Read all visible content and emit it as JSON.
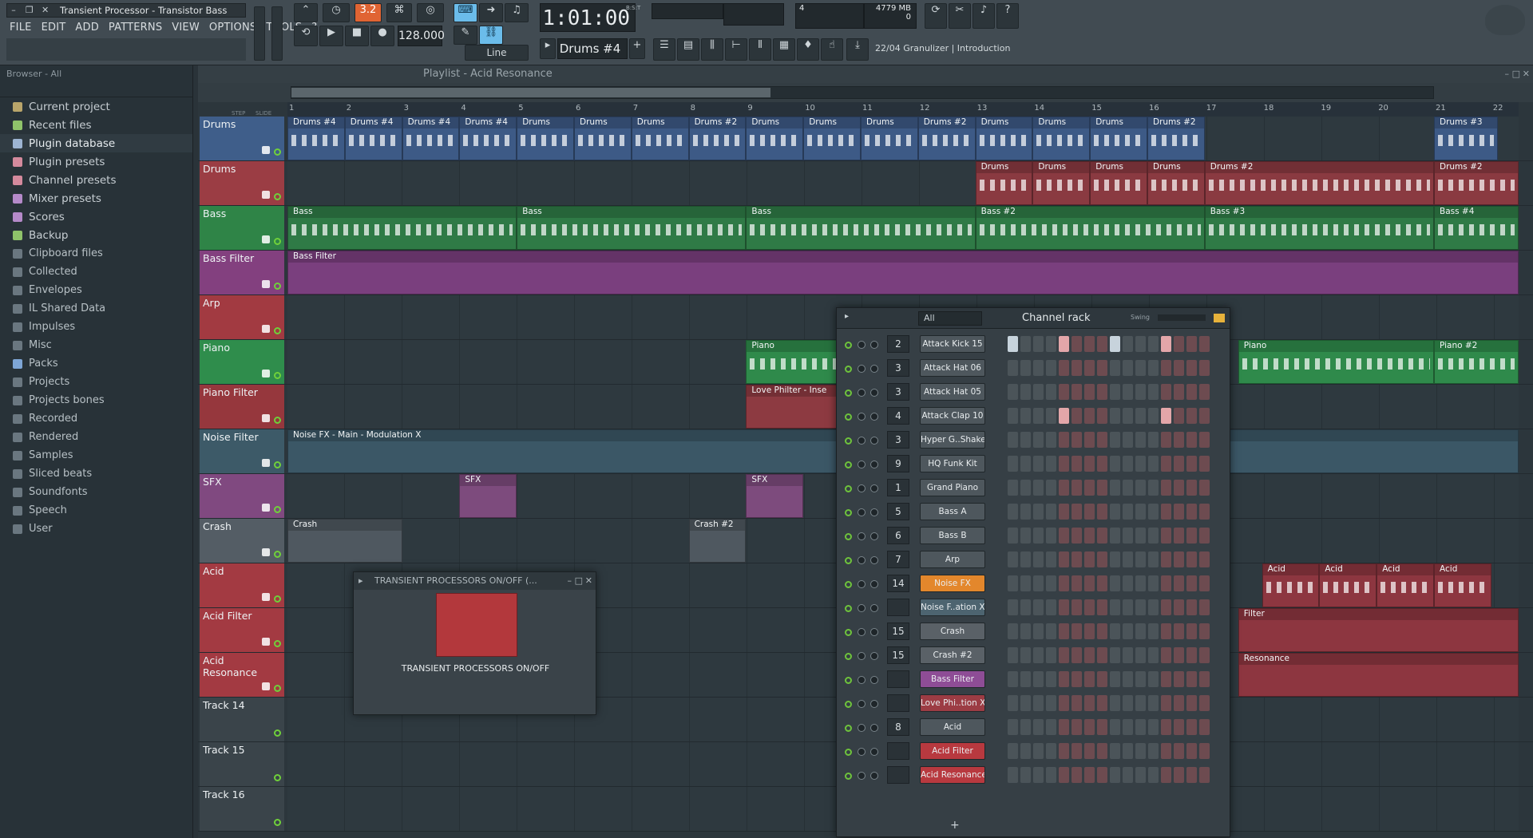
{
  "window": {
    "title": "Transient Processor - Transistor Bass",
    "controls": [
      "–",
      "□",
      "×"
    ]
  },
  "menu": [
    "FILE",
    "EDIT",
    "ADD",
    "PATTERNS",
    "VIEW",
    "OPTIONS",
    "TOOLS",
    "?"
  ],
  "transport": {
    "pattern_mode": "3.2",
    "tempo": "128.000",
    "snap": "Line",
    "time": "1:01:00",
    "time_label": "B:S:T",
    "pattern": "Drums #4",
    "cpu": "4",
    "ram": "4779 MB",
    "polyphony": "0"
  },
  "news": "22/04  Granulizer | Introduction",
  "browser": {
    "header": "Browser - All",
    "items": [
      {
        "label": "Current project",
        "color": "#b9a56a"
      },
      {
        "label": "Recent files",
        "color": "#8fc36a"
      },
      {
        "label": "Plugin database",
        "color": "#9db4d2"
      },
      {
        "label": "Plugin presets",
        "color": "#d48a9d"
      },
      {
        "label": "Channel presets",
        "color": "#d48a9d"
      },
      {
        "label": "Mixer presets",
        "color": "#b58ac9"
      },
      {
        "label": "Scores",
        "color": "#b58ac9"
      },
      {
        "label": "Backup",
        "color": "#8fc36a"
      },
      {
        "label": "Clipboard files",
        "color": "#6a7780"
      },
      {
        "label": "Collected",
        "color": "#6a7780"
      },
      {
        "label": "Envelopes",
        "color": "#6a7780"
      },
      {
        "label": "IL Shared Data",
        "color": "#6a7780"
      },
      {
        "label": "Impulses",
        "color": "#6a7780"
      },
      {
        "label": "Misc",
        "color": "#6a7780"
      },
      {
        "label": "Packs",
        "color": "#7ea6d6"
      },
      {
        "label": "Projects",
        "color": "#6a7780"
      },
      {
        "label": "Projects bones",
        "color": "#6a7780"
      },
      {
        "label": "Recorded",
        "color": "#6a7780"
      },
      {
        "label": "Rendered",
        "color": "#6a7780"
      },
      {
        "label": "Samples",
        "color": "#6a7780"
      },
      {
        "label": "Sliced beats",
        "color": "#6a7780"
      },
      {
        "label": "Soundfonts",
        "color": "#6a7780"
      },
      {
        "label": "Speech",
        "color": "#6a7780"
      },
      {
        "label": "User",
        "color": "#6a7780"
      }
    ]
  },
  "playlist": {
    "title": "Playlist - Acid Resonance",
    "step_label": "STEP",
    "slide_label": "SLIDE",
    "bars": [
      "1",
      "2",
      "3",
      "4",
      "5",
      "6",
      "7",
      "8",
      "9",
      "10",
      "11",
      "12",
      "13",
      "14",
      "15",
      "16",
      "17",
      "18",
      "19",
      "20",
      "21",
      "22"
    ],
    "tracks": [
      {
        "name": "Drums",
        "color": "#3f5e8a"
      },
      {
        "name": "Drums",
        "color": "#9b3d44"
      },
      {
        "name": "Bass",
        "color": "#2f8447"
      },
      {
        "name": "Bass Filter",
        "color": "#83407f"
      },
      {
        "name": "Arp",
        "color": "#a23a41"
      },
      {
        "name": "Piano",
        "color": "#2f8d4c"
      },
      {
        "name": "Piano Filter",
        "color": "#96373d"
      },
      {
        "name": "Noise Filter",
        "color": "#3d5a68"
      },
      {
        "name": "SFX",
        "color": "#804980"
      },
      {
        "name": "Crash",
        "color": "#545d65"
      },
      {
        "name": "Acid",
        "color": "#a33a42"
      },
      {
        "name": "Acid Filter",
        "color": "#a33a42"
      },
      {
        "name": "Acid Resonance",
        "color": "#a33a42"
      },
      {
        "name": "Track 14",
        "color": "#3a444a"
      },
      {
        "name": "Track 15",
        "color": "#3a444a"
      },
      {
        "name": "Track 16",
        "color": "#3a444a"
      }
    ],
    "clips": {
      "drums_row": [
        "Drums #4",
        "Drums #4",
        "Drums #4",
        "Drums #4",
        "Drums",
        "Drums",
        "Drums",
        "Drums #2",
        "Drums",
        "Drums",
        "Drums",
        "Drums #2",
        "Drums",
        "Drums",
        "Drums",
        "Drums #2",
        "Drums #3"
      ],
      "drums2_row": [
        "Drums",
        "Drums",
        "Drums",
        "Drums",
        "Drums #2",
        "Drums #2"
      ],
      "bass_row": [
        "Bass",
        "Bass",
        "Bass",
        "Bass #2",
        "Bass #3",
        "Bass #4"
      ],
      "bass_filter": "Bass Filter",
      "piano_row": [
        "Piano",
        "Piano",
        "Piano #2"
      ],
      "piano_filter": "Love Philter - Inse",
      "noise_filter": "Noise FX - Main - Modulation X",
      "sfx_row": [
        "SFX",
        "SFX"
      ],
      "crash_row": [
        "Crash",
        "Crash #2"
      ],
      "acid_row": [
        "Acid",
        "Acid",
        "Acid",
        "Acid"
      ],
      "acid_filter": "Filter",
      "acid_res": "Resonance"
    }
  },
  "channel_rack": {
    "title": "Channel rack",
    "filter": "All",
    "swing_label": "Swing",
    "add": "+",
    "channels": [
      {
        "num": "2",
        "name": "Attack Kick 15",
        "color": "#4e575d",
        "pattern": [
          1,
          0,
          0,
          0,
          1,
          0,
          0,
          0,
          1,
          0,
          0,
          0,
          1,
          0,
          0,
          0
        ]
      },
      {
        "num": "3",
        "name": "Attack Hat 06",
        "color": "#4e575d",
        "pattern": [
          0,
          0,
          0,
          0,
          0,
          0,
          0,
          0,
          0,
          0,
          0,
          0,
          0,
          0,
          0,
          0
        ]
      },
      {
        "num": "3",
        "name": "Attack Hat 05",
        "color": "#4e575d",
        "pattern": [
          0,
          0,
          0,
          0,
          0,
          0,
          0,
          0,
          0,
          0,
          0,
          0,
          0,
          0,
          0,
          0
        ]
      },
      {
        "num": "4",
        "name": "Attack Clap 10",
        "color": "#4e575d",
        "pattern": [
          0,
          0,
          0,
          0,
          1,
          0,
          0,
          0,
          0,
          0,
          0,
          0,
          1,
          0,
          0,
          0
        ]
      },
      {
        "num": "3",
        "name": "Hyper G..Shaker",
        "color": "#4e575d",
        "pattern": [
          0,
          0,
          0,
          0,
          0,
          0,
          0,
          0,
          0,
          0,
          0,
          0,
          0,
          0,
          0,
          0
        ]
      },
      {
        "num": "9",
        "name": "HQ Funk Kit",
        "color": "#4e575d",
        "pattern": [
          0,
          0,
          0,
          0,
          0,
          0,
          0,
          0,
          0,
          0,
          0,
          0,
          0,
          0,
          0,
          0
        ]
      },
      {
        "num": "1",
        "name": "Grand Piano",
        "color": "#4e575d",
        "pattern": [
          0,
          0,
          0,
          0,
          0,
          0,
          0,
          0,
          0,
          0,
          0,
          0,
          0,
          0,
          0,
          0
        ]
      },
      {
        "num": "5",
        "name": "Bass A",
        "color": "#4e575d",
        "pattern": [
          0,
          0,
          0,
          0,
          0,
          0,
          0,
          0,
          0,
          0,
          0,
          0,
          0,
          0,
          0,
          0
        ]
      },
      {
        "num": "6",
        "name": "Bass B",
        "color": "#4e575d",
        "pattern": [
          0,
          0,
          0,
          0,
          0,
          0,
          0,
          0,
          0,
          0,
          0,
          0,
          0,
          0,
          0,
          0
        ]
      },
      {
        "num": "7",
        "name": "Arp",
        "color": "#4e575d",
        "pattern": [
          0,
          0,
          0,
          0,
          0,
          0,
          0,
          0,
          0,
          0,
          0,
          0,
          0,
          0,
          0,
          0
        ]
      },
      {
        "num": "14",
        "name": "Noise FX",
        "color": "#e3872c",
        "pattern": [
          0,
          0,
          0,
          0,
          0,
          0,
          0,
          0,
          0,
          0,
          0,
          0,
          0,
          0,
          0,
          0
        ]
      },
      {
        "num": "",
        "name": "Noise F..ation X",
        "color": "#4d6470",
        "pattern": [
          0,
          0,
          0,
          0,
          0,
          0,
          0,
          0,
          0,
          0,
          0,
          0,
          0,
          0,
          0,
          0
        ]
      },
      {
        "num": "15",
        "name": "Crash",
        "color": "#5a6167",
        "pattern": [
          0,
          0,
          0,
          0,
          0,
          0,
          0,
          0,
          0,
          0,
          0,
          0,
          0,
          0,
          0,
          0
        ]
      },
      {
        "num": "15",
        "name": "Crash #2",
        "color": "#5a6167",
        "pattern": [
          0,
          0,
          0,
          0,
          0,
          0,
          0,
          0,
          0,
          0,
          0,
          0,
          0,
          0,
          0,
          0
        ]
      },
      {
        "num": "",
        "name": "Bass Filter",
        "color": "#8e4d96",
        "pattern": [
          0,
          0,
          0,
          0,
          0,
          0,
          0,
          0,
          0,
          0,
          0,
          0,
          0,
          0,
          0,
          0
        ]
      },
      {
        "num": "",
        "name": "Love Phi..tion X",
        "color": "#9c3c44",
        "pattern": [
          0,
          0,
          0,
          0,
          0,
          0,
          0,
          0,
          0,
          0,
          0,
          0,
          0,
          0,
          0,
          0
        ]
      },
      {
        "num": "8",
        "name": "Acid",
        "color": "#4e575d",
        "pattern": [
          0,
          0,
          0,
          0,
          0,
          0,
          0,
          0,
          0,
          0,
          0,
          0,
          0,
          0,
          0,
          0
        ]
      },
      {
        "num": "",
        "name": "Acid Filter",
        "color": "#b8393f",
        "pattern": [
          0,
          0,
          0,
          0,
          0,
          0,
          0,
          0,
          0,
          0,
          0,
          0,
          0,
          0,
          0,
          0
        ]
      },
      {
        "num": "",
        "name": "Acid Resonance",
        "color": "#b8393f",
        "pattern": [
          0,
          0,
          0,
          0,
          0,
          0,
          0,
          0,
          0,
          0,
          0,
          0,
          0,
          0,
          0,
          0
        ]
      }
    ]
  },
  "plugin_window": {
    "title": "TRANSIENT PROCESSORS ON/OFF (...",
    "label": "TRANSIENT PROCESSORS ON/OFF"
  }
}
